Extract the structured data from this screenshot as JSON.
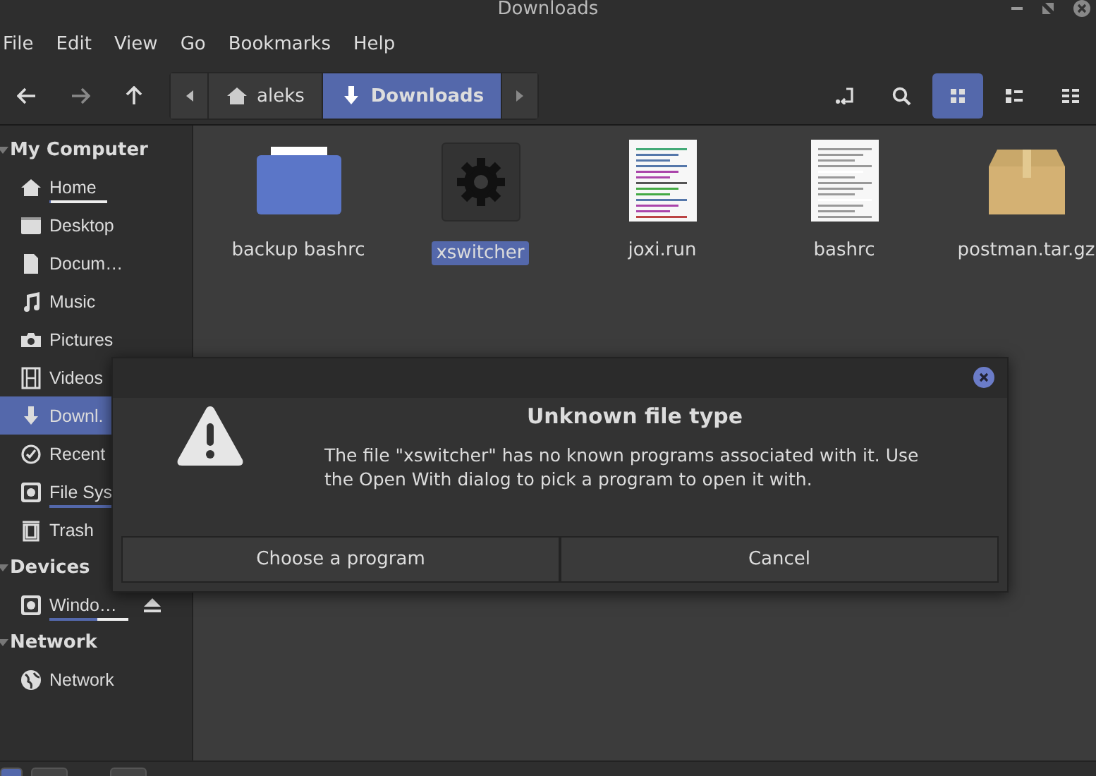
{
  "window": {
    "title": "Downloads"
  },
  "menu": [
    "File",
    "Edit",
    "View",
    "Go",
    "Bookmarks",
    "Help"
  ],
  "breadcrumb": [
    {
      "label": "aleks",
      "kind": "home",
      "selected": false
    },
    {
      "label": "Downloads",
      "kind": "download",
      "selected": true
    }
  ],
  "view_modes": [
    {
      "kind": "icons",
      "selected": true
    },
    {
      "kind": "compact",
      "selected": false
    },
    {
      "kind": "list",
      "selected": false
    }
  ],
  "sidebar": [
    {
      "label": "My Computer",
      "expanded": true,
      "items": [
        {
          "label": "Home",
          "kind": "home",
          "selected": false,
          "level": 0.02
        },
        {
          "label": "Desktop",
          "kind": "desktop",
          "selected": false
        },
        {
          "label": "Docum…",
          "kind": "document",
          "selected": false
        },
        {
          "label": "Music",
          "kind": "music",
          "selected": false
        },
        {
          "label": "Pictures",
          "kind": "camera",
          "selected": false
        },
        {
          "label": "Videos",
          "kind": "film",
          "selected": false
        },
        {
          "label": "Downl.",
          "kind": "download",
          "selected": true
        },
        {
          "label": "Recent",
          "kind": "clock",
          "selected": false
        },
        {
          "label": "File Sys",
          "kind": "disk",
          "selected": false,
          "level": 0.95
        },
        {
          "label": "Trash",
          "kind": "trash",
          "selected": false
        }
      ]
    },
    {
      "label": "Devices",
      "expanded": true,
      "items": [
        {
          "label": "Windo…",
          "kind": "disk",
          "selected": false,
          "level": 0.6,
          "ejectable": true
        }
      ]
    },
    {
      "label": "Network",
      "expanded": true,
      "items": [
        {
          "label": "Network",
          "kind": "globe",
          "selected": false
        }
      ]
    }
  ],
  "files": [
    {
      "name": "backup bashrc",
      "kind": "folder",
      "selected": false
    },
    {
      "name": "xswitcher",
      "kind": "executable",
      "selected": true
    },
    {
      "name": "joxi.run",
      "kind": "script",
      "selected": false
    },
    {
      "name": "bashrc",
      "kind": "text",
      "selected": false
    },
    {
      "name": "postman.tar.gz",
      "kind": "archive",
      "selected": false
    }
  ],
  "dialog": {
    "title": "Unknown file type",
    "message": "The file \"xswitcher\" has no known programs associated with it.  Use the Open With dialog to pick a program to open it with.",
    "buttons": [
      "Choose a program",
      "Cancel"
    ]
  }
}
